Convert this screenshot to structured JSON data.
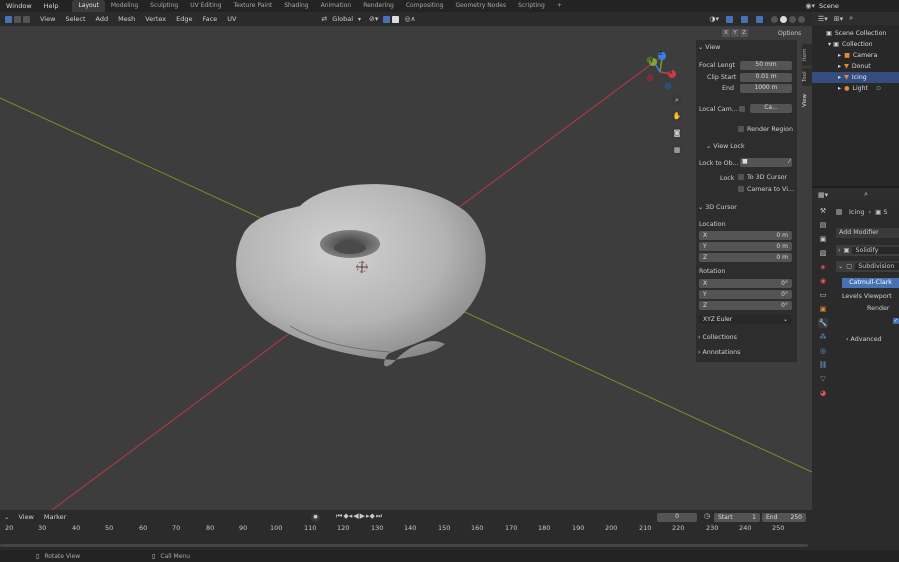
{
  "topbar": {
    "menus": [
      "Window",
      "Help"
    ],
    "workspaces": [
      "Layout",
      "Modeling",
      "Sculpting",
      "UV Editing",
      "Texture Paint",
      "Shading",
      "Animation",
      "Rendering",
      "Compositing",
      "Geometry Nodes",
      "Scripting"
    ],
    "active_workspace": "Layout",
    "add_tab": "+",
    "scene": "Scene"
  },
  "header": {
    "menus": [
      "View",
      "Select",
      "Add",
      "Mesh",
      "Vertex",
      "Edge",
      "Face",
      "UV"
    ],
    "orientation": "Global"
  },
  "viewport": {
    "options_label": "Options",
    "axes": [
      "X",
      "Y",
      "Z"
    ],
    "gizmo": {
      "y": "Y",
      "x": "X",
      "z": "Z"
    }
  },
  "npanel": {
    "tabs": [
      "Item",
      "Tool",
      "View"
    ],
    "view_section": "View",
    "focal_length_label": "Focal Lengt",
    "focal_length_value": "50 mm",
    "clip_start_label": "Clip Start",
    "clip_start_value": "0.01 m",
    "clip_end_label": "End",
    "clip_end_value": "1000 m",
    "local_camera_label": "Local Cam...",
    "local_camera_value": "Ca...",
    "render_region_label": "Render Region",
    "view_lock_section": "View Lock",
    "lock_to_object_label": "Lock to Ob...",
    "lock_label": "Lock",
    "to_3d_cursor_label": "To 3D Cursor",
    "camera_to_view_label": "Camera to Vi...",
    "cursor_section": "3D Cursor",
    "location_label": "Location",
    "loc": [
      {
        "axis": "X",
        "value": "0 m"
      },
      {
        "axis": "Y",
        "value": "0 m"
      },
      {
        "axis": "Z",
        "value": "0 m"
      }
    ],
    "rotation_label": "Rotation",
    "rot": [
      {
        "axis": "X",
        "value": "0°"
      },
      {
        "axis": "Y",
        "value": "0°"
      },
      {
        "axis": "Z",
        "value": "0°"
      }
    ],
    "rotation_mode": "XYZ Euler",
    "collections_section": "Collections",
    "annotations_section": "Annotations"
  },
  "outliner": {
    "scene_collection": "Scene Collection",
    "collection": "Collection",
    "items": [
      "Camera",
      "Donut",
      "Icing",
      "Light"
    ],
    "selected_item": "Icing"
  },
  "properties": {
    "object_name": "Icing",
    "add_modifier": "Add Modifier",
    "modifiers": [
      "Solidify",
      "Subdivision"
    ],
    "subdivision_type": "Catmull-Clark",
    "levels_viewport_label": "Levels Viewport",
    "render_label": "Render",
    "advanced_label": "Advanced"
  },
  "timeline": {
    "menus": [
      "View",
      "Marker"
    ],
    "current_frame": "0",
    "start_label": "Start",
    "start_value": "1",
    "end_label": "End",
    "end_value": "250",
    "ticks": [
      "20",
      "30",
      "40",
      "50",
      "60",
      "70",
      "80",
      "90",
      "100",
      "110",
      "120",
      "130",
      "140",
      "150",
      "160",
      "170",
      "180",
      "190",
      "200",
      "210",
      "220",
      "230",
      "240",
      "250"
    ]
  },
  "status": {
    "rotate_view": "Rotate View",
    "call_menu": "Call Menu"
  },
  "colors": {
    "accent": "#4772b3",
    "x_axis": "#c83d4a",
    "y_axis": "#7fa32a",
    "z_axis": "#3a7ee6",
    "viewport_bg": "#3d3d3d"
  }
}
